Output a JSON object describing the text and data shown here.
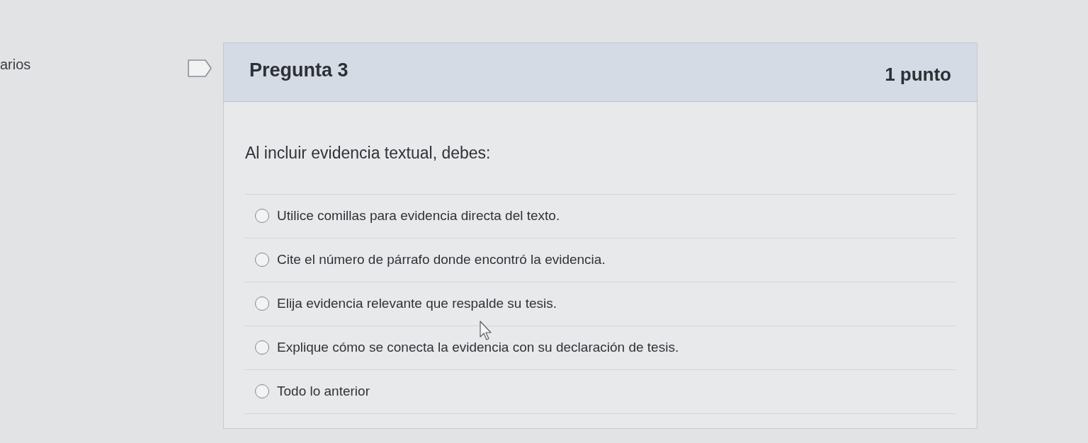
{
  "sidebar": {
    "label": "arios"
  },
  "question": {
    "title": "Pregunta 3",
    "points": "1 punto",
    "prompt": "Al incluir evidencia textual, debes:",
    "options": [
      {
        "text": "Utilice comillas para evidencia directa del texto.",
        "selected": false
      },
      {
        "text": "Cite el número de párrafo donde encontró la evidencia.",
        "selected": false
      },
      {
        "text": "Elija evidencia relevante que respalde su tesis.",
        "selected": false
      },
      {
        "text": "Explique cómo se conecta la evidencia con su declaración de tesis.",
        "selected": false
      },
      {
        "text": "Todo lo anterior",
        "selected": false
      }
    ]
  }
}
